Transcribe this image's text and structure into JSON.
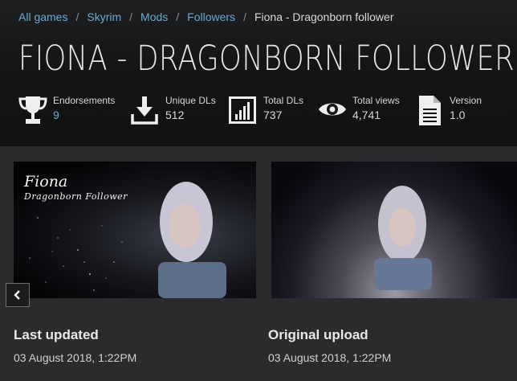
{
  "breadcrumb": {
    "items": [
      "All games",
      "Skyrim",
      "Mods",
      "Followers"
    ],
    "separator": "/",
    "current": "Fiona - Dragonborn follower"
  },
  "title": "FIONA - DRAGONBORN FOLLOWER",
  "stats": [
    {
      "icon": "trophy-icon",
      "label": "Endorsements",
      "value": "9"
    },
    {
      "icon": "download-icon",
      "label": "Unique DLs",
      "value": "512"
    },
    {
      "icon": "bar-chart-icon",
      "label": "Total DLs",
      "value": "737"
    },
    {
      "icon": "eye-icon",
      "label": "Total views",
      "value": "4,741"
    },
    {
      "icon": "document-icon",
      "label": "Version",
      "value": "1.0"
    }
  ],
  "gallery": {
    "image1_caption_title": "Fiona",
    "image1_caption_subtitle": "Dragonborn Follower"
  },
  "meta": {
    "last_updated_label": "Last updated",
    "last_updated_value": "03 August 2018,  1:22PM",
    "original_upload_label": "Original upload",
    "original_upload_value": "03 August 2018,  1:22PM"
  },
  "colors": {
    "link": "#6aaad2",
    "background": "#2a2b2d",
    "header": "#141516"
  }
}
